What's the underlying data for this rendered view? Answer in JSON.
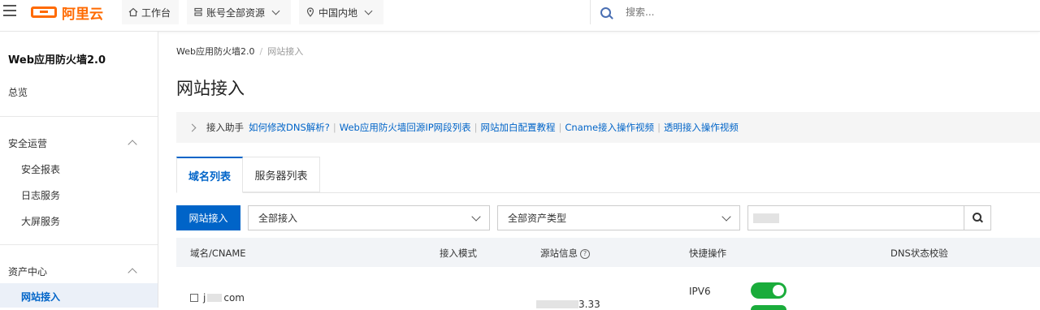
{
  "topbar": {
    "logo_text": "阿里云",
    "workbench": "工作台",
    "resources": "账号全部资源",
    "region": "中国内地",
    "search_placeholder": "搜索..."
  },
  "sidebar": {
    "title": "Web应用防火墙2.0",
    "overview": "总览",
    "security_ops": "安全运营",
    "security_report": "安全报表",
    "log_service": "日志服务",
    "big_screen": "大屏服务",
    "asset_center": "资产中心",
    "website_access": "网站接入"
  },
  "breadcrumb": {
    "root": "Web应用防火墙2.0",
    "sep": "/",
    "current": "网站接入"
  },
  "page_title": "网站接入",
  "helper": {
    "label": "接入助手",
    "links": [
      "如何修改DNS解析?",
      "Web应用防火墙回源IP网段列表",
      "网站加白配置教程",
      "Cname接入操作视频",
      "透明接入操作视频"
    ],
    "separator": "|"
  },
  "tabs": [
    "域名列表",
    "服务器列表"
  ],
  "toolbar": {
    "primary": "网站接入",
    "access_filter": "全部接入",
    "asset_type_filter": "全部资产类型"
  },
  "table": {
    "headers": [
      "域名/CNAME",
      "接入模式",
      "源站信息",
      "快捷操作",
      "DNS状态校验"
    ],
    "row": {
      "domain_prefix": "j",
      "domain_suffix": "com",
      "source_suffix": "3.33",
      "quick_label": "IPV6",
      "toggle_on": true
    }
  },
  "colors": {
    "brand": "#ff6a00",
    "primary": "#0064c8",
    "toggle": "#1aac3b"
  }
}
